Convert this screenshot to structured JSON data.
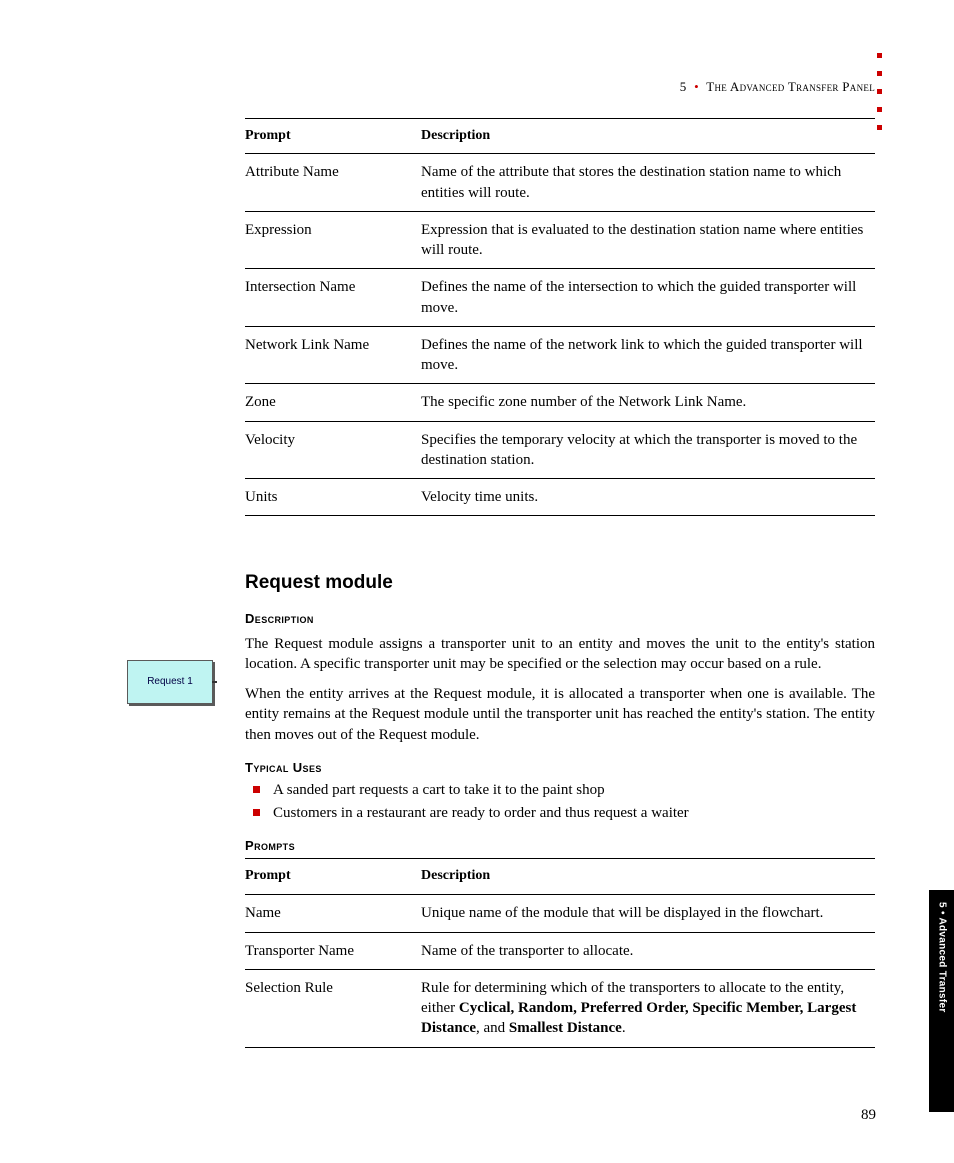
{
  "header": {
    "chapter_num": "5",
    "chapter_title": "The Advanced Transfer Panel"
  },
  "table1": {
    "col_prompt": "Prompt",
    "col_desc": "Description",
    "rows": [
      {
        "prompt": "Attribute Name",
        "desc": "Name of the attribute that stores the destination station name to which entities will route."
      },
      {
        "prompt": "Expression",
        "desc": "Expression that is evaluated to the destination station name where entities will route."
      },
      {
        "prompt": "Intersection Name",
        "desc": "Defines the name of the intersection to which the guided transporter will move."
      },
      {
        "prompt": "Network Link Name",
        "desc": "Defines the name of the network link to which the guided transporter will move."
      },
      {
        "prompt": "Zone",
        "desc": "The specific zone number of the Network Link Name."
      },
      {
        "prompt": "Velocity",
        "desc": "Specifies the temporary velocity at which the transporter is moved to the destination station."
      },
      {
        "prompt": "Units",
        "desc": "Velocity time units."
      }
    ]
  },
  "section": {
    "title": "Request module",
    "h_desc": "Description",
    "p1": "The Request module assigns a transporter unit to an entity and moves the unit to the entity's station location. A specific transporter unit may be specified or the selection may occur based on a rule.",
    "p2": "When the entity arrives at the Request module, it is allocated a transporter when one is available. The entity remains at the Request module until the transporter unit has reached the entity's station. The entity then moves out of the Request module.",
    "h_uses": "Typical Uses",
    "uses": [
      "A sanded part requests a cart to take it to the paint shop",
      "Customers in a restaurant are ready to order and thus request a waiter"
    ],
    "h_prompts": "Prompts"
  },
  "module_icon_label": "Request 1",
  "table2": {
    "col_prompt": "Prompt",
    "col_desc": "Description",
    "rows": [
      {
        "prompt": "Name",
        "desc": "Unique name of the module that will be displayed in the flowchart."
      },
      {
        "prompt": "Transporter Name",
        "desc": "Name of the transporter to allocate."
      },
      {
        "prompt": "Selection Rule",
        "desc_pre": "Rule for determining which of the transporters to allocate to the entity, either ",
        "desc_bold": "Cyclical, Random, Preferred Order, Specific Member, Largest Distance",
        "desc_mid": ", and ",
        "desc_bold2": "Smallest Distance",
        "desc_post": "."
      }
    ]
  },
  "side_tab": "5 • Advanced Transfer",
  "page_number": "89"
}
